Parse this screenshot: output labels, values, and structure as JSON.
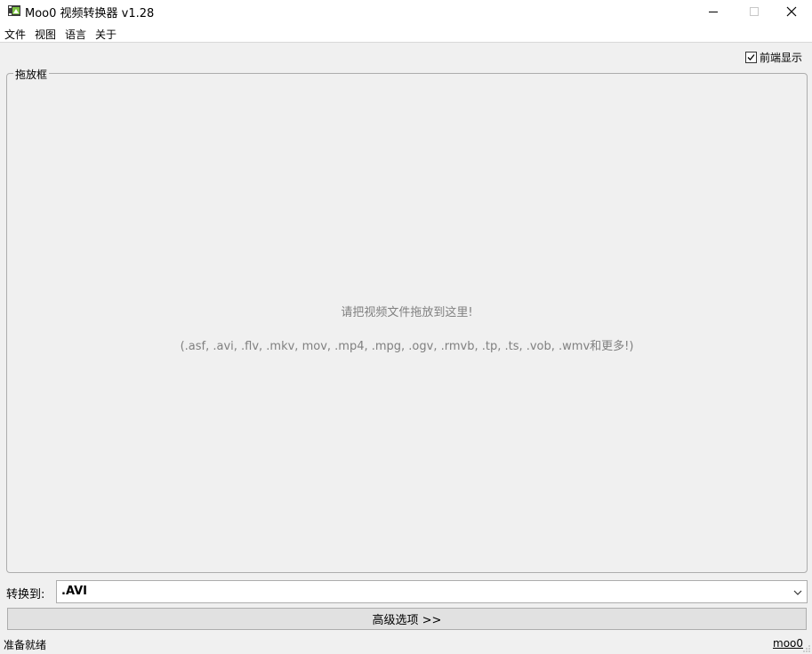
{
  "window": {
    "title": "Moo0 视频转换器 v1.28",
    "icon": "app-icon"
  },
  "menu": {
    "items": [
      "文件",
      "视图",
      "语言",
      "关于"
    ]
  },
  "topmost": {
    "label": "前端显示",
    "checked": true
  },
  "dropbox": {
    "legend": "拖放框",
    "hint": "请把视频文件拖放到这里!",
    "formats": "(.asf, .avi, .flv, .mkv, mov, .mp4, .mpg, .ogv, .rmvb, .tp, .ts, .vob, .wmv和更多!)"
  },
  "convert": {
    "label": "转换到:",
    "selected": ".AVI"
  },
  "advanced": {
    "label": "高级选项 >>"
  },
  "status": {
    "text": "准备就绪",
    "link": "moo0"
  }
}
